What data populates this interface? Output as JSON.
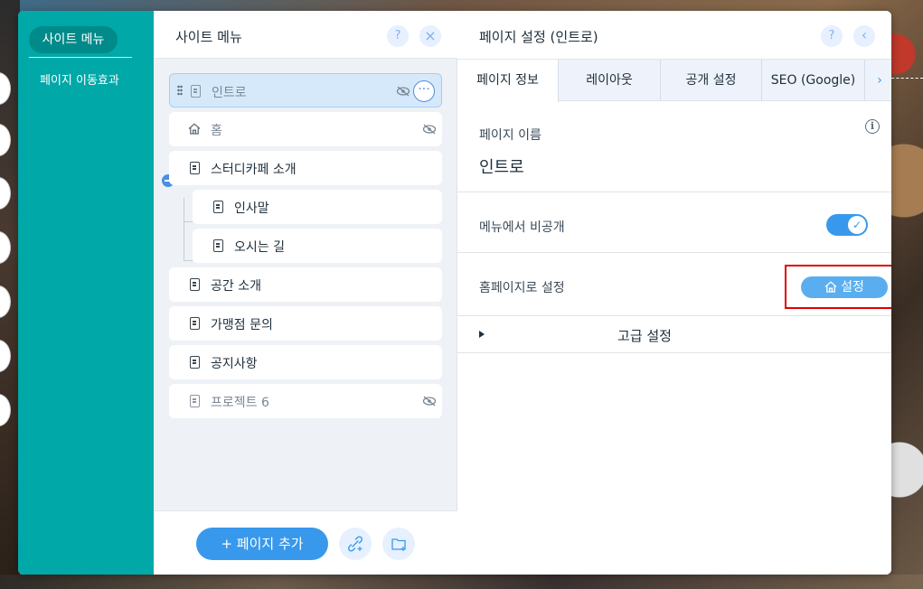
{
  "sidebar": {
    "active_item": "사이트 메뉴",
    "items": [
      "페이지 이동효과"
    ]
  },
  "site_menu": {
    "title": "사이트 메뉴",
    "help_icon": "?",
    "close_icon": "×",
    "pages": [
      {
        "label": "인트로",
        "selected": true,
        "hidden": true,
        "icon": "page-icon"
      },
      {
        "label": "홈",
        "selected": false,
        "hidden": true,
        "icon": "home-icon"
      },
      {
        "label": "스터디카페 소개",
        "selected": false,
        "hidden": false,
        "icon": "page-icon",
        "expanded": true
      },
      {
        "label": "인사말",
        "selected": false,
        "hidden": false,
        "icon": "page-icon",
        "subpage": true
      },
      {
        "label": "오시는 길",
        "selected": false,
        "hidden": false,
        "icon": "page-icon",
        "subpage": true
      },
      {
        "label": "공간 소개",
        "selected": false,
        "hidden": false,
        "icon": "page-icon"
      },
      {
        "label": "가맹점 문의",
        "selected": false,
        "hidden": false,
        "icon": "page-icon"
      },
      {
        "label": "공지사항",
        "selected": false,
        "hidden": false,
        "icon": "page-icon"
      },
      {
        "label": "프로젝트 6",
        "selected": false,
        "hidden": true,
        "icon": "page-icon"
      }
    ],
    "more_glyph": "···",
    "add_page_label": "+ 페이지 추가",
    "link_icon": "🔗",
    "folder_icon": "📁"
  },
  "page_settings": {
    "title": "페이지 설정 (인트로)",
    "help_icon": "?",
    "back_icon": "‹",
    "tabs": [
      "페이지 정보",
      "레이아웃",
      "공개 설정",
      "SEO (Google)"
    ],
    "active_tab": "페이지 정보",
    "tab_next_icon": "›",
    "info_icon": "i",
    "page_name_label": "페이지 이름",
    "page_name_value": "인트로",
    "hide_in_menu_label": "메뉴에서 비공개",
    "hide_in_menu_on": true,
    "toggle_check": "✓",
    "set_home_label": "홈페이지로 설정",
    "set_home_button": "설정",
    "advanced_label": "고급 설정"
  },
  "colors": {
    "teal": "#00a8a8",
    "accent": "#3899ec",
    "highlight": "#e00000"
  }
}
